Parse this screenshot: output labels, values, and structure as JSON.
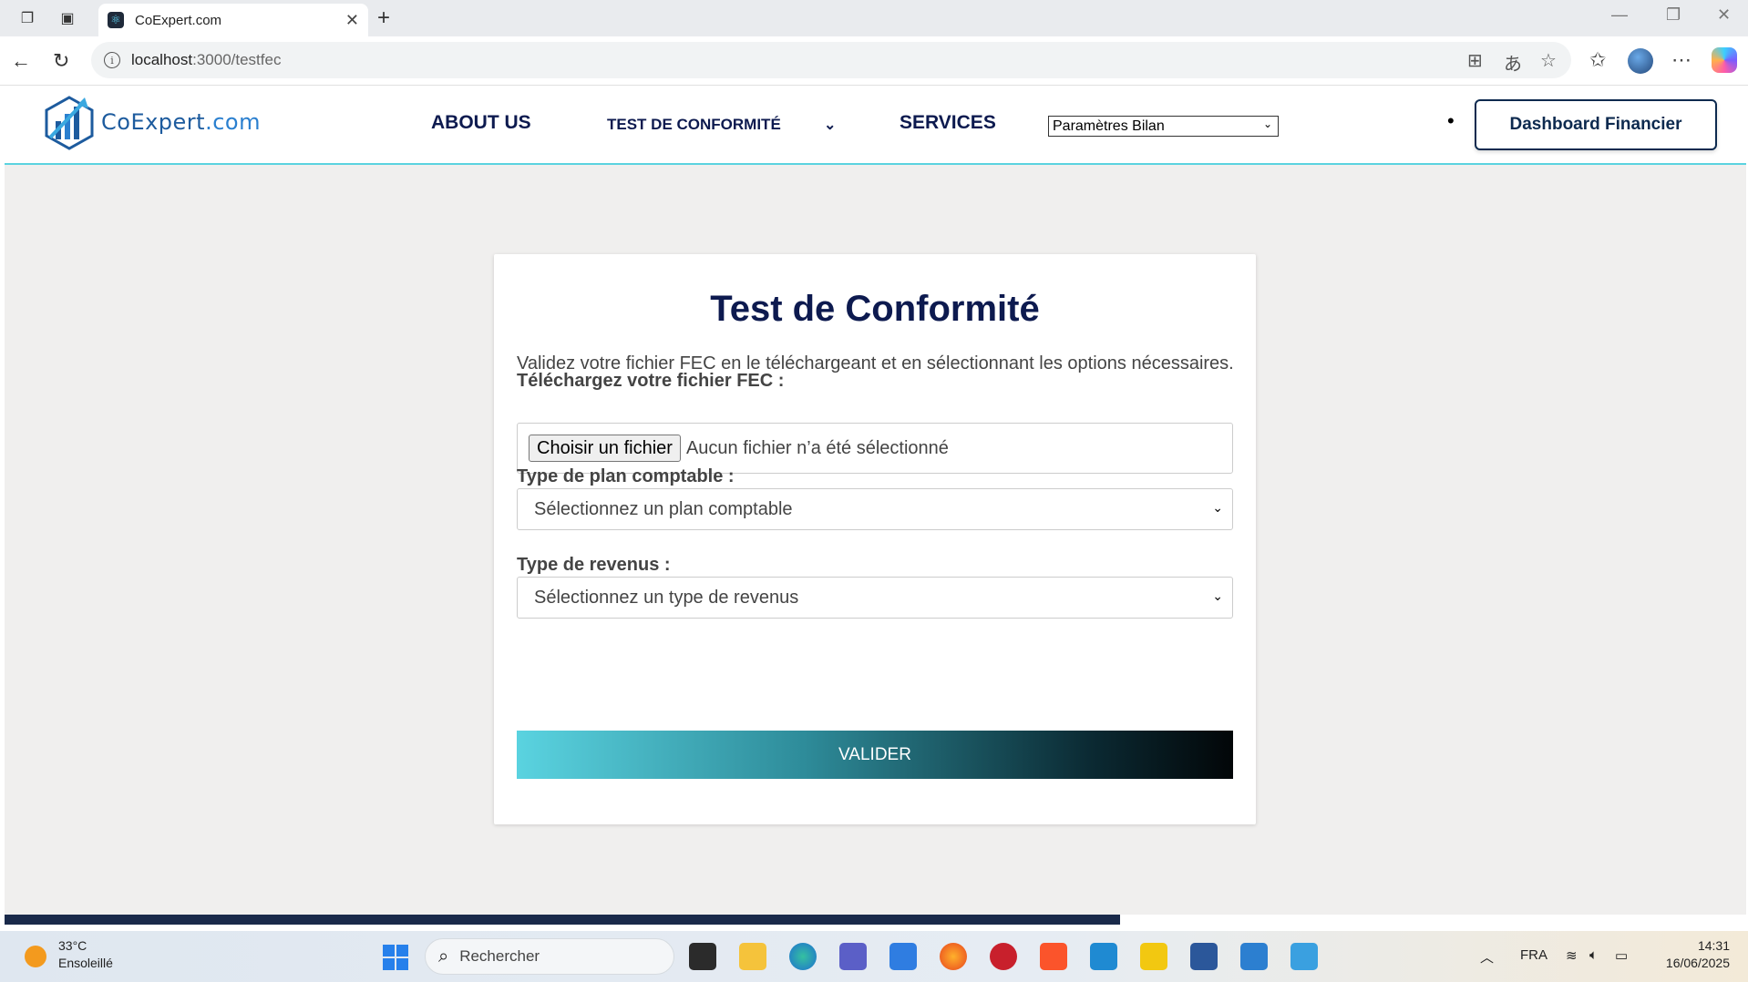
{
  "browser": {
    "tab_title": "CoExpert.com",
    "url_host": "localhost",
    "url_path": ":3000/testfec"
  },
  "header": {
    "logo_text_main": "CoExpert",
    "logo_text_domain": ".com",
    "nav_about": "ABOUT US",
    "nav_test": "TEST DE CONFORMITÉ",
    "nav_services": "SERVICES",
    "bilan_select_value": "Paramètres Bilan",
    "dashboard_button": "Dashboard Financier"
  },
  "form": {
    "title": "Test de Conformité",
    "subtitle": "Validez votre fichier FEC en le téléchargeant et en sélectionnant les options nécessaires.",
    "file_label": "Téléchargez votre fichier FEC :",
    "file_button": "Choisir un fichier",
    "file_status": "Aucun fichier n’a été sélectionné",
    "plan_label": "Type de plan comptable :",
    "plan_placeholder": "Sélectionnez un plan comptable",
    "revenue_label": "Type de revenus :",
    "revenue_placeholder": "Sélectionnez un type de revenus",
    "submit_label": "VALIDER"
  },
  "taskbar": {
    "weather_temp": "33°C",
    "weather_desc": "Ensoleillé",
    "search_placeholder": "Rechercher",
    "language": "FRA",
    "time": "14:31",
    "date": "16/06/2025"
  },
  "colors": {
    "brand_navy": "#0d1a4f",
    "accent_cyan": "#5ad3e0"
  }
}
